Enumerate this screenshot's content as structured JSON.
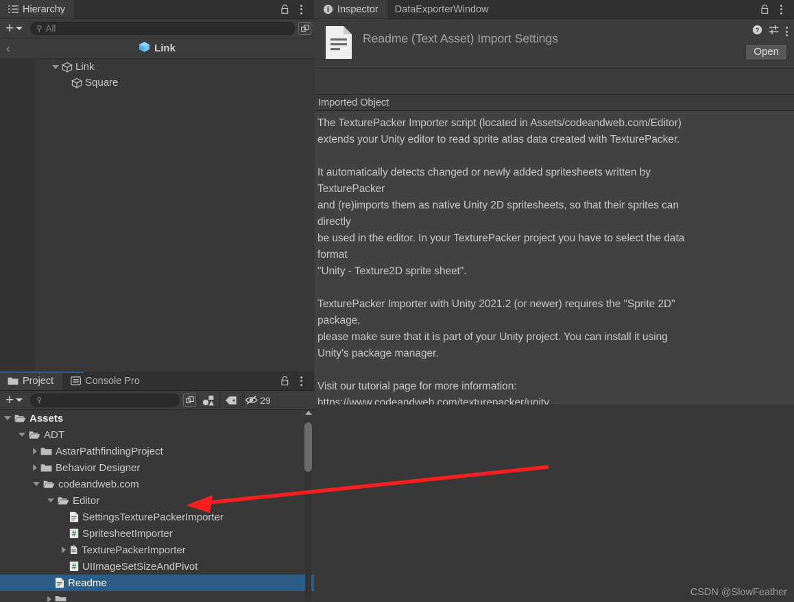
{
  "hierarchy": {
    "tab": {
      "label": "Hierarchy",
      "icon": "hierarchy-list-icon"
    },
    "toolbar": {
      "add_label": "+",
      "search_value": "",
      "search_placeholder": "All",
      "popout_icon": "popout-window-icon"
    },
    "breadcrumb": {
      "back_icon": "chevron-left-icon",
      "label": "Link",
      "icon": "prefab-cube-icon"
    },
    "items": [
      {
        "name": "Link",
        "expanded": true,
        "indent": 1,
        "icon": "gameobject-cube-icon",
        "toggle": "triangle-down"
      },
      {
        "name": "Square",
        "expanded": false,
        "indent": 2,
        "icon": "gameobject-cube-icon",
        "toggle": "none"
      }
    ]
  },
  "inspector": {
    "tabs": [
      {
        "label": "Inspector",
        "icon": "info-circle-icon",
        "active": true
      },
      {
        "label": "DataExporterWindow",
        "icon": "none",
        "active": false
      }
    ],
    "header": {
      "title": "Readme (Text Asset) Import Settings",
      "icon": "text-asset-document-icon",
      "help_icon": "help-circle-icon",
      "preset_icon": "preset-sliders-icon",
      "menu_icon": "kebab-menu-icon",
      "open_label": "Open"
    },
    "imported_object_label": "Imported Object",
    "readme_text": "The TexturePacker Importer script (located in Assets/codeandweb.com/Editor)\nextends your Unity editor to read sprite atlas data created with TexturePacker.\n\nIt automatically detects changed or newly added spritesheets written by\nTexturePacker\nand (re)imports them as native Unity 2D spritesheets, so that their sprites can\ndirectly\nbe used in the editor. In your TexturePacker project you have to select the data\nformat\n\"Unity - Texture2D sprite sheet\".\n\nTexturePacker Importer with Unity 2021.2 (or newer) requires the \"Sprite 2D\"\npackage,\nplease make sure that it is part of your Unity project. You can install it using\nUnity's package manager.\n\nVisit our tutorial page for more information:\nhttps://www.codeandweb.com/texturepacker/unity"
  },
  "project": {
    "tabs": [
      {
        "label": "Project",
        "icon": "folder-icon",
        "active": true
      },
      {
        "label": "Console Pro",
        "icon": "console-icon",
        "active": false
      }
    ],
    "toolbar": {
      "add_label": "+",
      "search_value": "",
      "search_placeholder": "",
      "popout_icon": "popout-window-icon",
      "type_filter_icon": "shapes-filter-icon",
      "label_filter_icon": "tag-label-icon",
      "hidden_icon": "eye-slash-icon",
      "hidden_count": "29"
    },
    "items": [
      {
        "name": "Assets",
        "indent": 0,
        "toggle": "triangle-down",
        "icon": "folder-open-icon",
        "selected": false,
        "bold": true
      },
      {
        "name": "ADT",
        "indent": 1,
        "toggle": "triangle-down",
        "icon": "folder-open-icon",
        "selected": false,
        "bold": false
      },
      {
        "name": "AstarPathfindingProject",
        "indent": 2,
        "toggle": "triangle-right",
        "icon": "folder-icon",
        "selected": false,
        "bold": false
      },
      {
        "name": "Behavior Designer",
        "indent": 2,
        "toggle": "triangle-right",
        "icon": "folder-icon",
        "selected": false,
        "bold": false
      },
      {
        "name": "codeandweb.com",
        "indent": 2,
        "toggle": "triangle-down",
        "icon": "folder-open-icon",
        "selected": false,
        "bold": false
      },
      {
        "name": "Editor",
        "indent": 3,
        "toggle": "triangle-down",
        "icon": "folder-open-icon",
        "selected": false,
        "bold": false
      },
      {
        "name": "SettingsTexturePackerImporter",
        "indent": 4,
        "toggle": "none",
        "icon": "text-asset-icon",
        "selected": false,
        "bold": false
      },
      {
        "name": "SpritesheetImporter",
        "indent": 4,
        "toggle": "none",
        "icon": "csharp-script-icon",
        "selected": false,
        "bold": false
      },
      {
        "name": "TexturePackerImporter",
        "indent": 4,
        "toggle": "triangle-right",
        "icon": "assembly-icon",
        "selected": false,
        "bold": false
      },
      {
        "name": "UIImageSetSizeAndPivot",
        "indent": 4,
        "toggle": "none",
        "icon": "csharp-script-icon",
        "selected": false,
        "bold": false
      },
      {
        "name": "Readme",
        "indent": 3,
        "toggle": "none",
        "icon": "text-asset-icon",
        "selected": true,
        "bold": false
      }
    ],
    "scrollbar": {
      "up_icon": "scroll-up-arrow-icon"
    }
  },
  "annotation": {
    "arrow_color": "#f51f1f",
    "watermark": "CSDN @SlowFeather"
  },
  "colors": {
    "selection_blue": "#2c5d87",
    "panel_bg": "#383838",
    "tab_bg": "#303030",
    "toolbar_bg": "#3c3c3c",
    "text_body": "#c8c8c8",
    "prefab_blue": "#6bc4f5",
    "csharp_green": "#3d9c52"
  }
}
